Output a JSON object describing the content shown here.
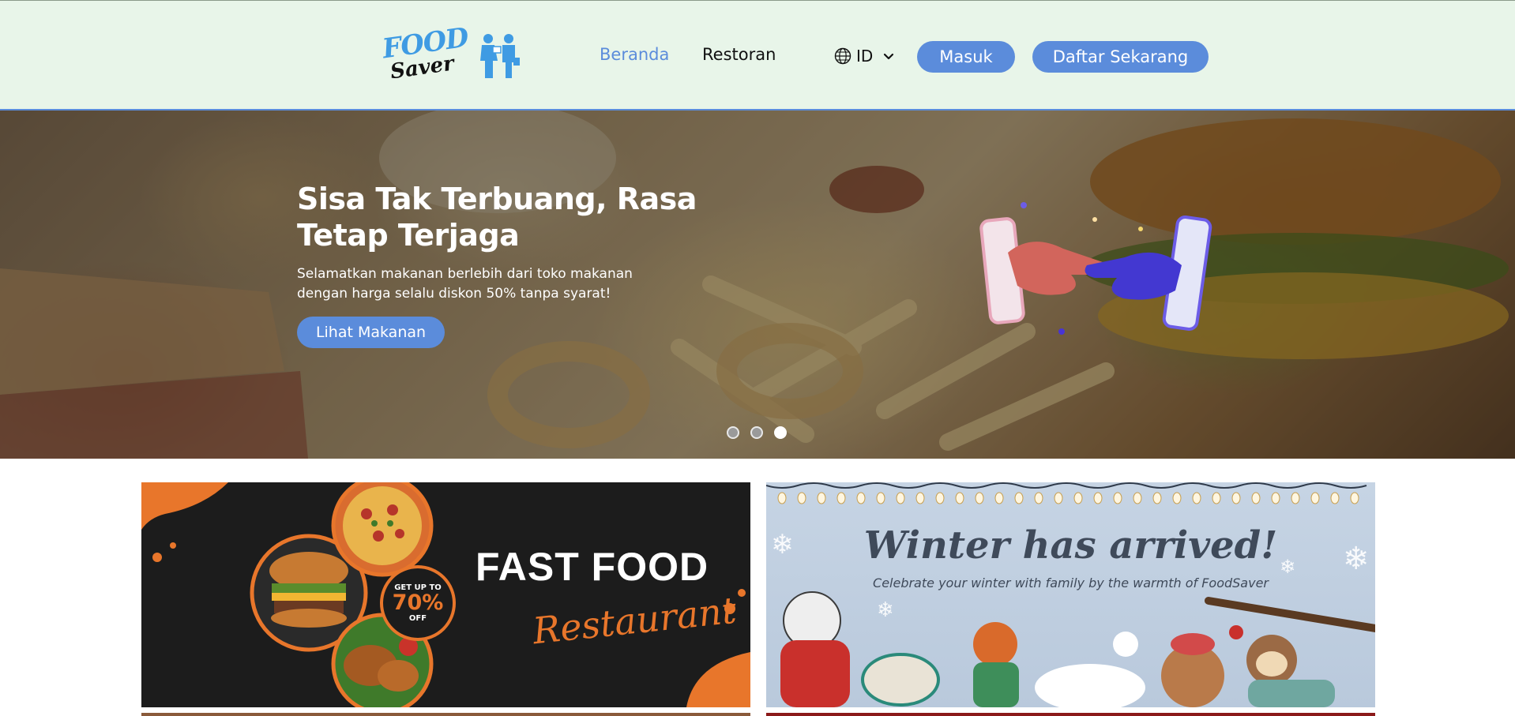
{
  "header": {
    "logo": {
      "line1": "FOOD",
      "line2": "Saver"
    },
    "nav": [
      {
        "label": "Beranda",
        "active": true
      },
      {
        "label": "Restoran",
        "active": false
      }
    ],
    "language": {
      "code": "ID",
      "icon": "globe-icon",
      "chevron": "chevron-down-icon"
    },
    "login_label": "Masuk",
    "register_label": "Daftar Sekarang"
  },
  "hero": {
    "title": "Sisa Tak Terbuang, Rasa Tetap Terjaga",
    "subtitle": "Selamatkan makanan berlebih dari toko makanan dengan harga selalu diskon 50% tanpa syarat!",
    "cta_label": "Lihat Makanan",
    "slides": 3,
    "active_slide": 3
  },
  "banners": {
    "fast_food": {
      "title": "FAST FOOD",
      "script": "Restaurant",
      "badge_top": "GET UP TO",
      "badge_value": "70%",
      "badge_bottom": "OFF"
    },
    "winter": {
      "title": "Winter has arrived!",
      "subtitle": "Celebrate your winter with family by the warmth of FoodSaver"
    }
  },
  "colors": {
    "accent": "#5b8cdb",
    "header_bg": "#e8f5e9",
    "orange": "#e8762b"
  }
}
